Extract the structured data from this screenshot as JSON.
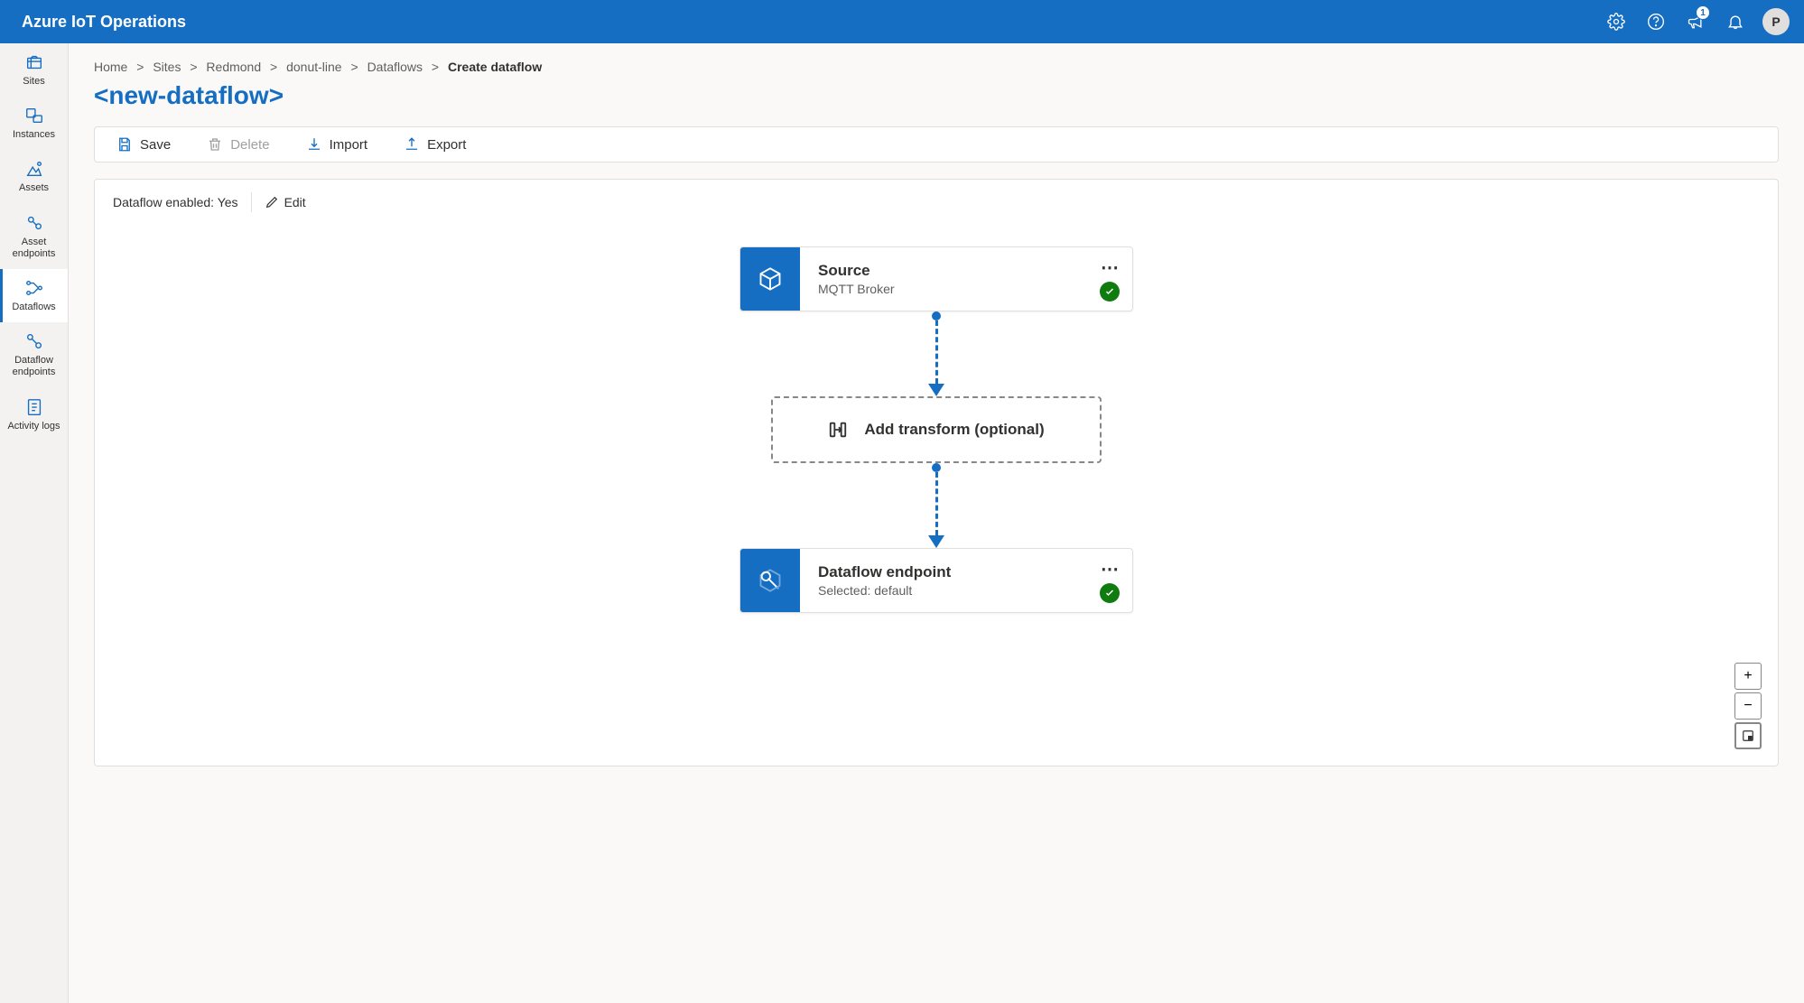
{
  "header": {
    "title": "Azure IoT Operations",
    "notification_count": "1",
    "avatar_initial": "P"
  },
  "sidebar": {
    "items": [
      {
        "label": "Sites"
      },
      {
        "label": "Instances"
      },
      {
        "label": "Assets"
      },
      {
        "label": "Asset endpoints"
      },
      {
        "label": "Dataflows"
      },
      {
        "label": "Dataflow endpoints"
      },
      {
        "label": "Activity logs"
      }
    ]
  },
  "breadcrumbs": {
    "items": [
      "Home",
      "Sites",
      "Redmond",
      "donut-line",
      "Dataflows"
    ],
    "current": "Create dataflow",
    "sep": ">"
  },
  "page_title": "<new-dataflow>",
  "toolbar": {
    "save": "Save",
    "delete": "Delete",
    "import": "Import",
    "export": "Export"
  },
  "status": {
    "enabled_label": "Dataflow enabled: ",
    "enabled_value": "Yes",
    "edit": "Edit"
  },
  "flow": {
    "source": {
      "title": "Source",
      "subtitle": "MQTT Broker"
    },
    "transform": {
      "label": "Add transform (optional)"
    },
    "endpoint": {
      "title": "Dataflow endpoint",
      "subtitle": "Selected: default"
    }
  },
  "zoom": {
    "in": "+",
    "out": "−"
  }
}
